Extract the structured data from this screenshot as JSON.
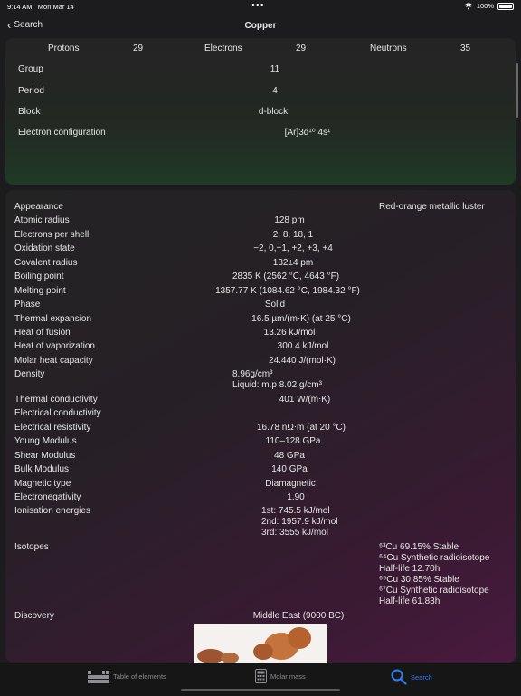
{
  "status": {
    "time": "9:14 AM",
    "date": "Mon Mar 14",
    "battery": "100%"
  },
  "nav": {
    "back_label": "Search",
    "title": "Copper"
  },
  "counts": {
    "protons_label": "Protons",
    "protons": "29",
    "electrons_label": "Electrons",
    "electrons": "29",
    "neutrons_label": "Neutrons",
    "neutrons": "35"
  },
  "summary": [
    {
      "label": "Group",
      "value": "11"
    },
    {
      "label": "Period",
      "value": "4"
    },
    {
      "label": "Block",
      "value": "d-block"
    },
    {
      "label": "Electron configuration",
      "value": "[Ar]3d¹⁰ 4s¹"
    }
  ],
  "properties": {
    "appearance": {
      "label": "Appearance",
      "value": "Red-orange metallic luster"
    },
    "atomic_radius": {
      "label": "Atomic radius",
      "value": "128 pm"
    },
    "electrons_per_shell": {
      "label": "Electrons per shell",
      "value": "2, 8, 18, 1"
    },
    "oxidation_state": {
      "label": "Oxidation state",
      "value": "−2, 0,+1, +2, +3, +4"
    },
    "covalent_radius": {
      "label": "Covalent radius",
      "value": "132±4 pm"
    },
    "boiling_point": {
      "label": "Boiling point",
      "value": "2835 K (2562 °C, 4643 °F)"
    },
    "melting_point": {
      "label": "Melting point",
      "value": "1357.77 K (1084.62 °C, 1984.32 °F)"
    },
    "phase": {
      "label": "Phase",
      "value": "Solid"
    },
    "thermal_expansion": {
      "label": "Thermal expansion",
      "value": "16.5 µm/(m⋅K) (at 25 °C)"
    },
    "heat_of_fusion": {
      "label": "Heat of fusion",
      "value": "13.26 kJ/mol"
    },
    "heat_of_vaporization": {
      "label": "Heat of vaporization",
      "value": "300.4 kJ/mol"
    },
    "molar_heat_capacity": {
      "label": "Molar heat capacity",
      "value": "24.440 J/(mol·K)"
    },
    "density": {
      "label": "Density",
      "line1": "8.96g/cm³",
      "line2": "Liquid: m.p 8.02 g/cm³"
    },
    "thermal_conductivity": {
      "label": "Thermal conductivity",
      "value": "401 W/(m⋅K)"
    },
    "electrical_conductivity": {
      "label": "Electrical conductivity",
      "value": ""
    },
    "electrical_resistivity": {
      "label": "Electrical resistivity",
      "value": "16.78 nΩ⋅m (at 20 °C)"
    },
    "young_modulus": {
      "label": "Young Modulus",
      "value": "110–128 GPa"
    },
    "shear_modulus": {
      "label": "Shear Modulus",
      "value": "48 GPa"
    },
    "bulk_modulus": {
      "label": "Bulk Modulus",
      "value": "140 GPa"
    },
    "magnetic_type": {
      "label": "Magnetic type",
      "value": "Diamagnetic"
    },
    "electronegativity": {
      "label": "Electronegativity",
      "value": "1.90"
    },
    "ionisation_energies": {
      "label": "Ionisation energies",
      "lines": [
        "1st: 745.5 kJ/mol",
        "2nd: 1957.9 kJ/mol",
        "3rd: 3555 kJ/mol"
      ]
    },
    "isotopes": {
      "label": "Isotopes",
      "lines": [
        "⁶³Cu 69.15% Stable",
        "⁶⁴Cu   Synthetic radioisotope",
        "Half-life 12.70h",
        "⁶⁵Cu 30.85% Stable",
        "⁶⁷Cu   Synthetic radioisotope",
        "Half-life 61.83h"
      ]
    },
    "discovery": {
      "label": "Discovery",
      "value": "Middle East (9000 BC)"
    }
  },
  "tabs": [
    {
      "label": "Table of elements",
      "icon": "periodic-table-icon"
    },
    {
      "label": "Molar mass",
      "icon": "calculator-icon"
    },
    {
      "label": "Search",
      "icon": "search-icon"
    }
  ],
  "colors": {
    "accent": "#2f7bf6",
    "summary_tint": "#1f3a25",
    "properties_tint": "#4a1a3f"
  }
}
